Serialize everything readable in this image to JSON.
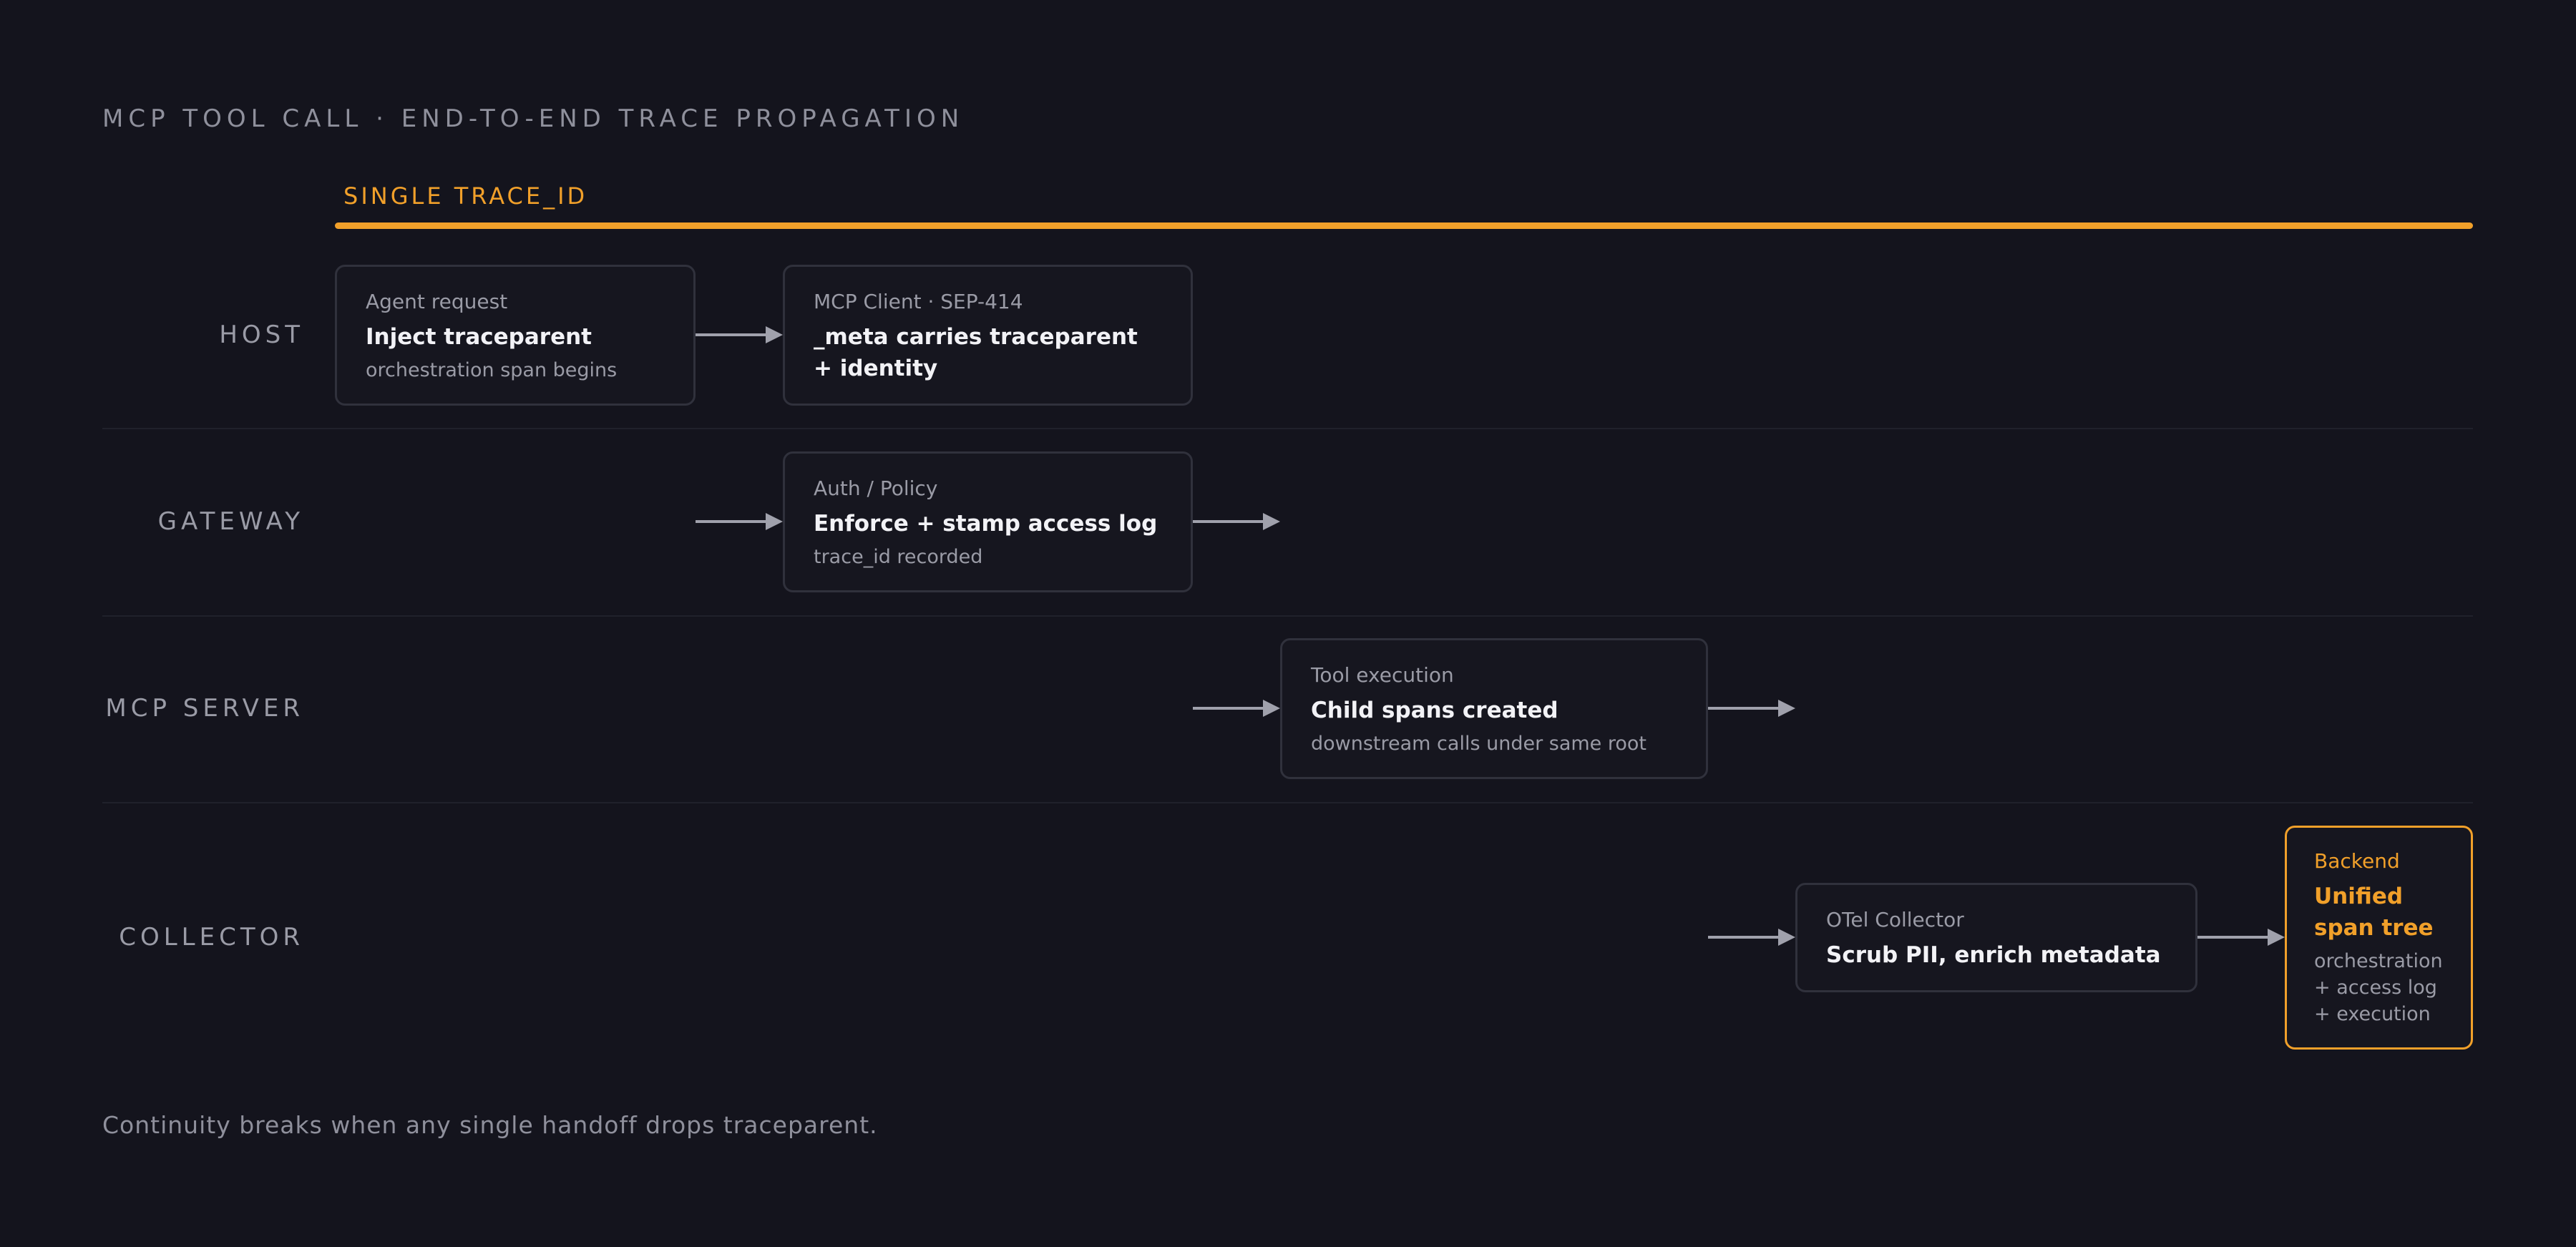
{
  "title": "MCP TOOL CALL · END-TO-END TRACE PROPAGATION",
  "trace": {
    "label": "SINGLE TRACE_ID",
    "color": "#f1a02a"
  },
  "lanes": [
    {
      "label": "HOST"
    },
    {
      "label": "GATEWAY"
    },
    {
      "label": "MCP SERVER"
    },
    {
      "label": "COLLECTOR"
    }
  ],
  "boxes": {
    "agent_request": {
      "kicker": "Agent request",
      "main": "Inject traceparent",
      "sub": "orchestration span begins"
    },
    "mcp_client": {
      "kicker": "MCP Client · SEP-414",
      "main": "_meta carries traceparent + identity",
      "sub": ""
    },
    "auth_policy": {
      "kicker": "Auth / Policy",
      "main": "Enforce + stamp access log",
      "sub": "trace_id recorded"
    },
    "tool_execution": {
      "kicker": "Tool execution",
      "main": "Child spans created",
      "sub": "downstream calls under same root"
    },
    "otel_collector": {
      "kicker": "OTel Collector",
      "main": "Scrub PII, enrich metadata",
      "sub": ""
    },
    "backend": {
      "kicker": "Backend",
      "main": "Unified span tree",
      "sub": "orchestration + access log + execution"
    }
  },
  "footnote": "Continuity breaks when any single handoff drops traceparent.",
  "colors": {
    "background": "#14141d",
    "accent": "#f1a02a",
    "box_border": "#30313c",
    "arrow": "#a0a1ac"
  }
}
